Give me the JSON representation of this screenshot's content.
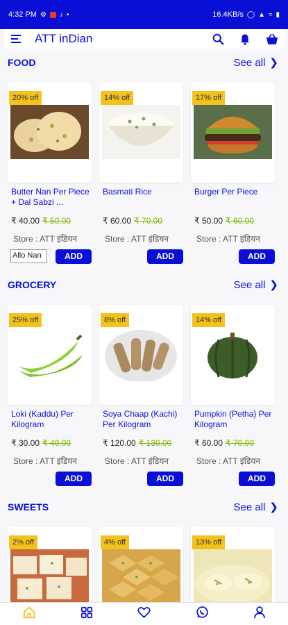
{
  "status": {
    "time": "4:32 PM",
    "speed": "16.4KB/s",
    "battery": "▮"
  },
  "appbar": {
    "title": "ATT inDian"
  },
  "sections": [
    {
      "title": "FOOD",
      "see_all": "See all",
      "items": [
        {
          "badge": "20% off",
          "name": "Butter Nan Per Piece + Dal Sabzi ...",
          "price": "₹ 40.00",
          "old_price": "₹ 50.00",
          "store": "Store : ATT इंडियन",
          "option": "Allo Nan",
          "add": "ADD",
          "image": "naan"
        },
        {
          "badge": "14% off",
          "name": "Basmati Rice",
          "price": "₹ 60.00",
          "old_price": "₹ 70.00",
          "store": "Store : ATT इंडियन",
          "option": "",
          "add": "ADD",
          "image": "rice"
        },
        {
          "badge": "17% off",
          "name": "Burger Per Piece",
          "price": "₹ 50.00",
          "old_price": "₹ 60.00",
          "store": "Store : ATT इंडियन",
          "option": "",
          "add": "ADD",
          "image": "burger"
        }
      ]
    },
    {
      "title": "GROCERY",
      "see_all": "See all",
      "items": [
        {
          "badge": "25% off",
          "name": "Loki (Kaddu) Per Kilogram",
          "price": "₹ 30.00",
          "old_price": "₹ 40.00",
          "store": "Store : ATT इंडियन",
          "option": "",
          "add": "ADD",
          "image": "banana"
        },
        {
          "badge": "8% off",
          "name": "Soya Chaap (Kachi) Per Kilogram",
          "price": "₹ 120.00",
          "old_price": "₹ 130.00",
          "store": "Store : ATT इंडियन",
          "option": "",
          "add": "ADD",
          "image": "chaap"
        },
        {
          "badge": "14% off",
          "name": "Pumpkin (Petha) Per Kilogram",
          "price": "₹ 60.00",
          "old_price": "₹ 70.00",
          "store": "Store : ATT इंडियन",
          "option": "",
          "add": "ADD",
          "image": "pumpkin"
        }
      ]
    },
    {
      "title": "SWEETS",
      "see_all": "See all",
      "items": [
        {
          "badge": "2% off",
          "image": "barfi"
        },
        {
          "badge": "4% off",
          "image": "kaju"
        },
        {
          "badge": "13% off",
          "image": "rasmalai"
        }
      ]
    }
  ],
  "nav": {
    "items": [
      "home-icon",
      "grid-icon",
      "heart-icon",
      "whatsapp-icon",
      "user-icon"
    ],
    "active": "home-icon"
  },
  "colors": {
    "brand": "#0a0fd6",
    "badge": "#f4c21d",
    "old_price": "#7cb800",
    "active_nav": "#f4c21d"
  }
}
